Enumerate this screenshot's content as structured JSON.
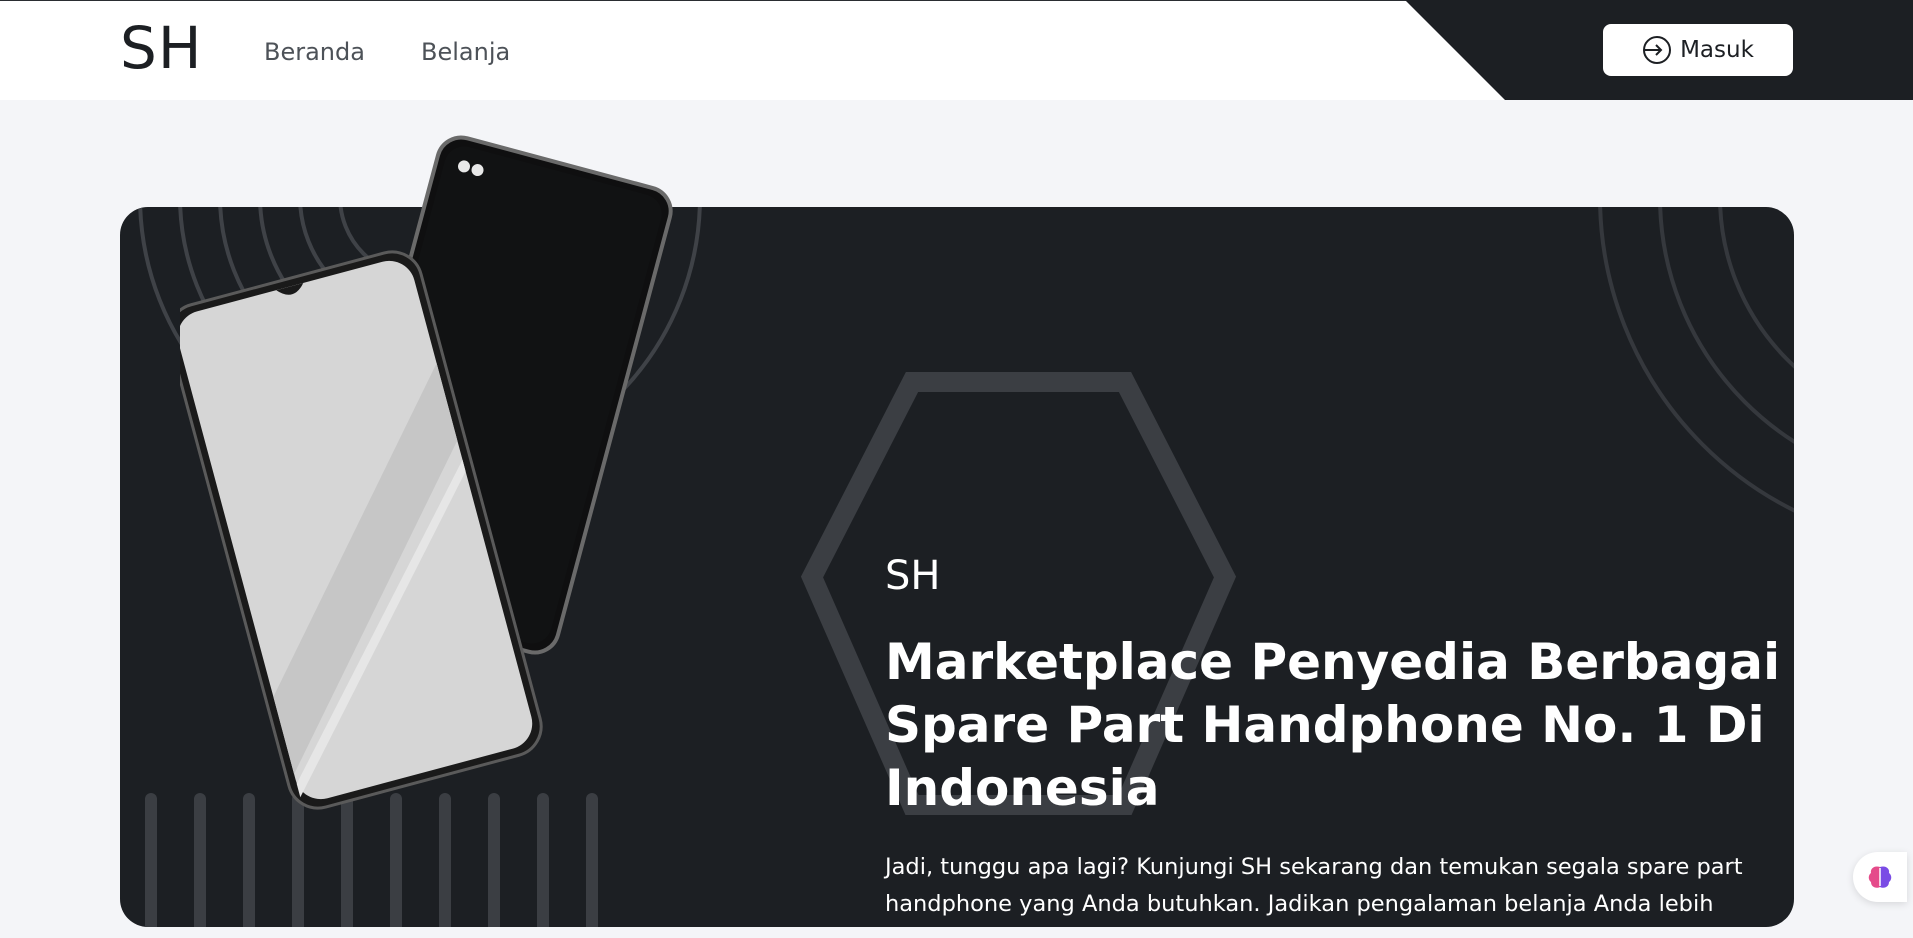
{
  "header": {
    "logo": "SH",
    "nav": [
      {
        "label": "Beranda"
      },
      {
        "label": "Belanja"
      }
    ],
    "login_label": "Masuk",
    "login_icon": "login-arrow-icon"
  },
  "hero": {
    "subtitle": "SH",
    "title": "Marketplace Penyedia Berbagai Spare Part Handphone No. 1 Di Indonesia",
    "description": "Jadi, tunggu apa lagi? Kunjungi SH sekarang dan temukan segala spare part handphone yang Anda butuhkan. Jadikan pengalaman belanja Anda lebih menyenangkan dengan SH, pasar online terbaik untuk spare part handphone!",
    "image": "smartphones-illustration"
  },
  "floating": {
    "icon": "brain-assistant-icon"
  },
  "colors": {
    "dark": "#1c1f23",
    "page_bg": "#f4f5f8",
    "text_light": "#ffffff",
    "nav_text": "#4d5258"
  }
}
